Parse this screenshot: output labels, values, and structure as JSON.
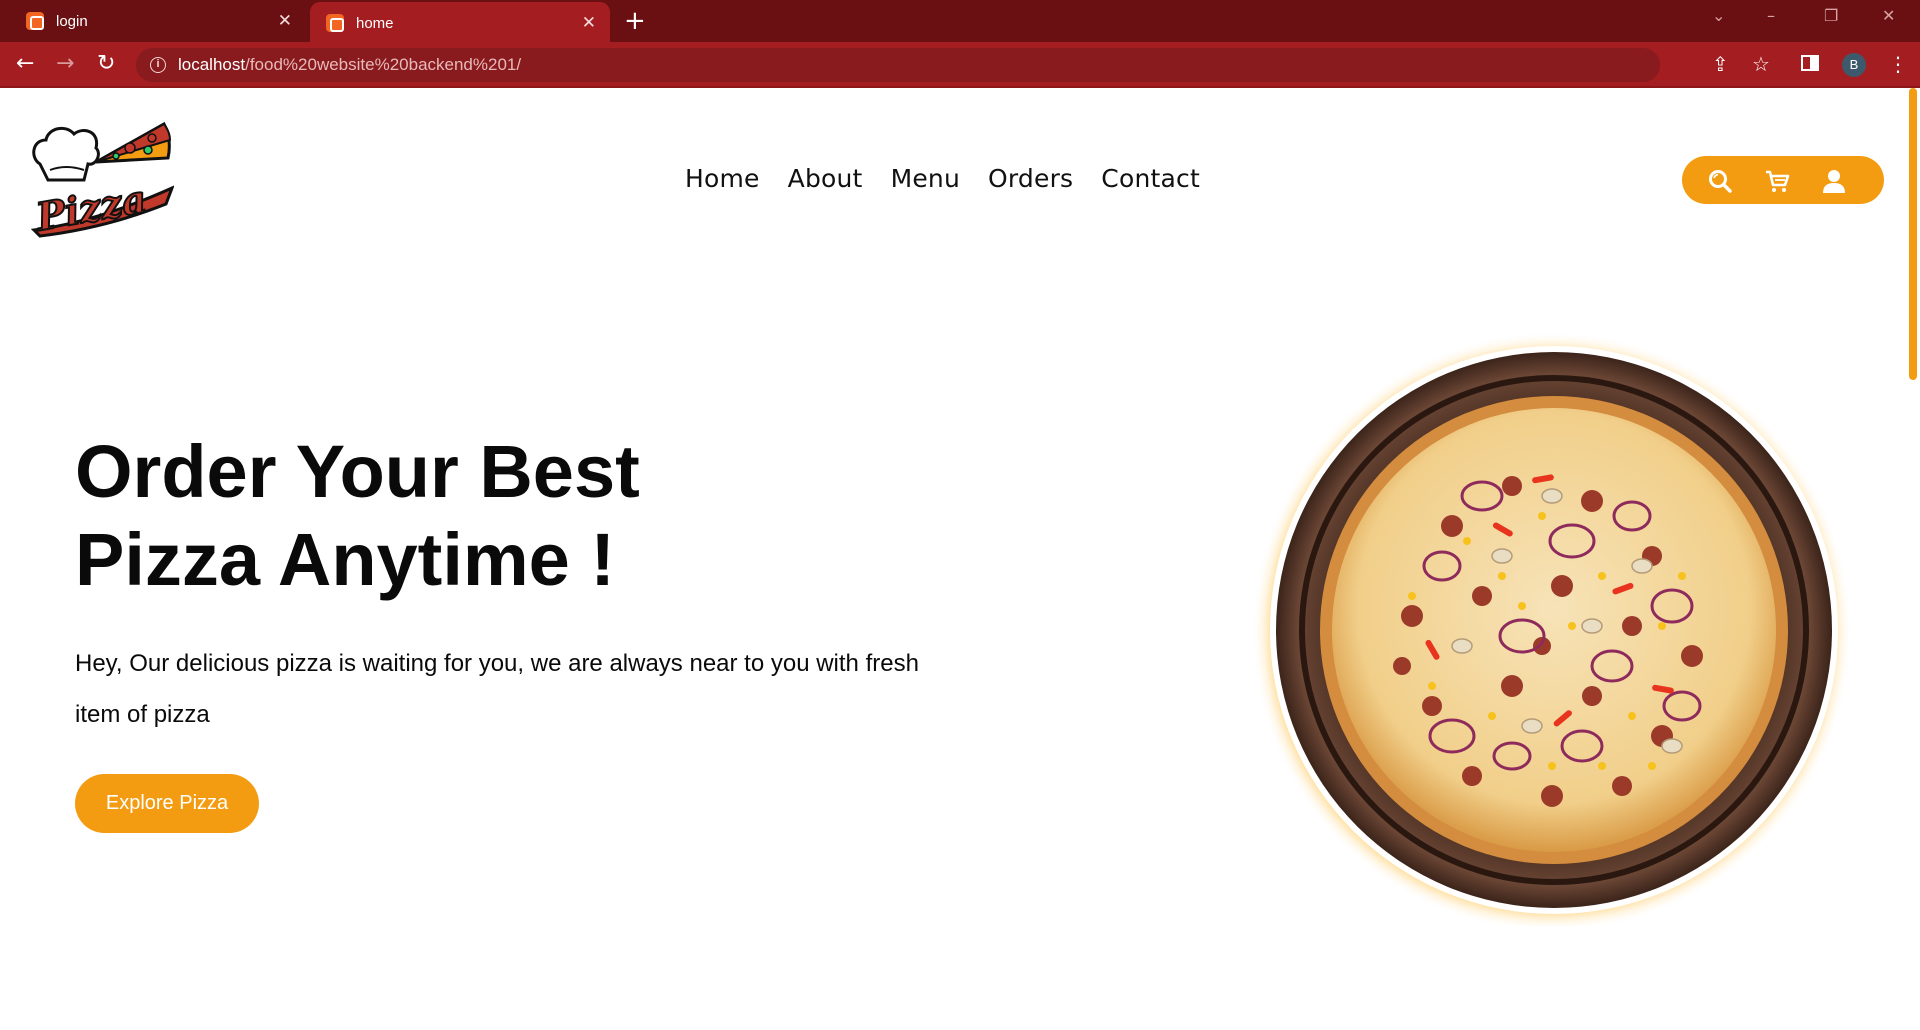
{
  "browser": {
    "tabs": [
      {
        "title": "login",
        "active": false
      },
      {
        "title": "home",
        "active": true
      }
    ],
    "new_tab_icon": "plus-icon",
    "url_host": "localhost",
    "url_path": "/food%20website%20backend%201/",
    "profile_initial": "B",
    "accent_color": "#a31d21"
  },
  "header": {
    "logo_text": "Pizza",
    "nav": [
      {
        "label": "Home"
      },
      {
        "label": "About"
      },
      {
        "label": "Menu"
      },
      {
        "label": "Orders"
      },
      {
        "label": "Contact"
      }
    ],
    "icons": [
      "search-icon",
      "cart-icon",
      "user-icon"
    ],
    "accent_color": "#f39c12"
  },
  "hero": {
    "title_line1": "Order Your Best",
    "title_line2": "Pizza Anytime !",
    "text": "Hey, Our delicious pizza is waiting for you, we are always near to you with fresh item of pizza",
    "cta_label": "Explore Pizza"
  }
}
